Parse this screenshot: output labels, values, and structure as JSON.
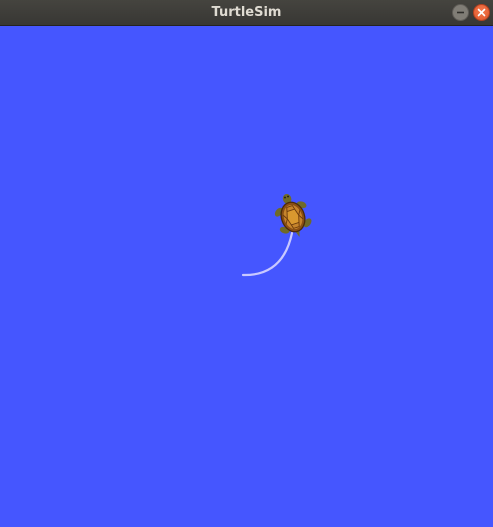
{
  "window": {
    "title": "TurtleSim",
    "buttons": {
      "minimize": "minimize-icon",
      "close": "close-icon"
    }
  },
  "canvas": {
    "background_color": "#4556ff",
    "pen_color": "#c8c8ff",
    "turtle_count": 1
  }
}
